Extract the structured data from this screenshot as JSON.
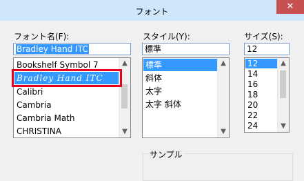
{
  "window": {
    "title": "フォント",
    "close_glyph": "✕"
  },
  "font_name": {
    "label": "フォント名(F):",
    "value": "Bradley Hand ITC",
    "items": [
      "Bookshelf Symbol 7",
      "Bradley Hand ITC",
      "Calibri",
      "Cambria",
      "Cambria Math",
      "CHRISTINA"
    ],
    "selected": "Bradley Hand ITC"
  },
  "style": {
    "label": "スタイル(Y):",
    "value": "標準",
    "items": [
      "標準",
      "斜体",
      "太字",
      "太字 斜体"
    ],
    "selected": "標準"
  },
  "size": {
    "label": "サイズ(S):",
    "value": "12",
    "items": [
      "12",
      "14",
      "16",
      "18",
      "20",
      "22",
      "24"
    ],
    "selected": "12"
  },
  "sample": {
    "label": "サンプル"
  },
  "colors": {
    "selection": "#3399ff",
    "highlight_box": "#e8001c",
    "titlebar": "#cfe7fb",
    "close": "#c75050"
  }
}
